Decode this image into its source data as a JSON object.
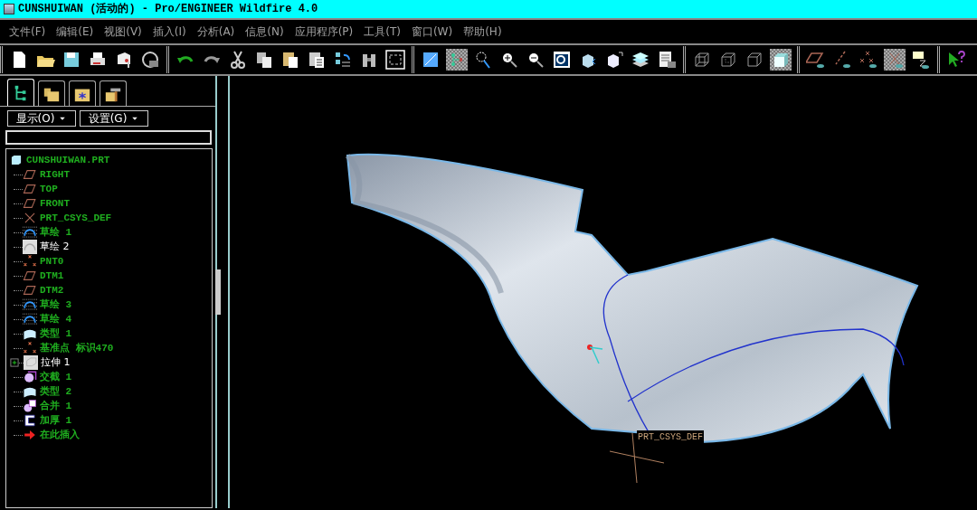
{
  "window": {
    "title": "CUNSHUIWAN (活动的) - Pro/ENGINEER Wildfire 4.0"
  },
  "menu": [
    "文件(F)",
    "编辑(E)",
    "视图(V)",
    "插入(I)",
    "分析(A)",
    "信息(N)",
    "应用程序(P)",
    "工具(T)",
    "窗口(W)",
    "帮助(H)"
  ],
  "toolbars": [
    {
      "buttons": [
        {
          "kind": "new",
          "on": false
        },
        {
          "kind": "open",
          "on": false
        },
        {
          "kind": "save",
          "on": false
        },
        {
          "kind": "print",
          "on": false
        },
        {
          "kind": "mail",
          "on": false
        },
        {
          "kind": "close",
          "on": false
        }
      ]
    },
    {
      "buttons": [
        {
          "kind": "undo",
          "on": false
        },
        {
          "kind": "redo",
          "on": false
        },
        {
          "kind": "cut",
          "on": false
        },
        {
          "kind": "copy",
          "on": false
        },
        {
          "kind": "paste",
          "on": false
        },
        {
          "kind": "paste-special",
          "on": false
        },
        {
          "kind": "regenerate",
          "on": false
        },
        {
          "kind": "binoculars",
          "on": false
        },
        {
          "kind": "select-box",
          "on": false
        }
      ]
    },
    {
      "buttons": [
        {
          "kind": "repaint",
          "on": false
        },
        {
          "kind": "spin-center",
          "on": true
        },
        {
          "kind": "orient",
          "on": false
        },
        {
          "kind": "zoom-in",
          "on": false
        },
        {
          "kind": "zoom-out",
          "on": false
        },
        {
          "kind": "refit",
          "on": false
        },
        {
          "kind": "reorient",
          "on": false
        },
        {
          "kind": "view-manager",
          "on": false
        },
        {
          "kind": "layers",
          "on": false
        },
        {
          "kind": "model-display",
          "on": false
        }
      ]
    },
    {
      "buttons": [
        {
          "kind": "wireframe",
          "on": false
        },
        {
          "kind": "hidden-line",
          "on": false
        },
        {
          "kind": "no-hidden",
          "on": false
        },
        {
          "kind": "shading",
          "on": true
        }
      ]
    },
    {
      "buttons": [
        {
          "kind": "plane",
          "on": false
        },
        {
          "kind": "axis",
          "on": false
        },
        {
          "kind": "point",
          "on": false
        },
        {
          "kind": "csys",
          "on": true
        },
        {
          "kind": "annotation",
          "on": false
        }
      ]
    },
    {
      "buttons": [
        {
          "kind": "help",
          "on": false
        }
      ]
    }
  ],
  "panel": {
    "tabs": [
      {
        "kind": "tree",
        "selected": true
      },
      {
        "kind": "folder",
        "selected": false
      },
      {
        "kind": "favorites",
        "selected": false
      },
      {
        "kind": "tools",
        "selected": false
      }
    ],
    "buttons": [
      "显示(O)",
      "设置(G)"
    ],
    "tree": {
      "root": "CUNSHUIWAN.PRT",
      "items": [
        {
          "label": "RIGHT",
          "kind": "plane",
          "highlighted": false,
          "expandable": false
        },
        {
          "label": "TOP",
          "kind": "plane",
          "highlighted": false,
          "expandable": false
        },
        {
          "label": "FRONT",
          "kind": "plane",
          "highlighted": false,
          "expandable": false
        },
        {
          "label": "PRT_CSYS_DEF",
          "kind": "csys",
          "highlighted": false,
          "expandable": false
        },
        {
          "label": "草绘 1",
          "kind": "sketch",
          "highlighted": false,
          "expandable": false
        },
        {
          "label": "草绘 2",
          "kind": "sketch-plain",
          "highlighted": true,
          "expandable": false
        },
        {
          "label": "PNT0",
          "kind": "point",
          "highlighted": false,
          "expandable": false
        },
        {
          "label": "DTM1",
          "kind": "plane",
          "highlighted": false,
          "expandable": false
        },
        {
          "label": "DTM2",
          "kind": "plane",
          "highlighted": false,
          "expandable": false
        },
        {
          "label": "草绘 3",
          "kind": "sketch",
          "highlighted": false,
          "expandable": false
        },
        {
          "label": "草绘 4",
          "kind": "sketch",
          "highlighted": false,
          "expandable": false
        },
        {
          "label": "类型 1",
          "kind": "surface",
          "highlighted": false,
          "expandable": false
        },
        {
          "label": "基准点 标识470",
          "kind": "point",
          "highlighted": false,
          "expandable": false
        },
        {
          "label": "拉伸 1",
          "kind": "extrude",
          "highlighted": true,
          "expandable": true
        },
        {
          "label": "交截 1",
          "kind": "intersect",
          "highlighted": false,
          "expandable": false
        },
        {
          "label": "类型 2",
          "kind": "surface",
          "highlighted": false,
          "expandable": false
        },
        {
          "label": "合并 1",
          "kind": "merge",
          "highlighted": false,
          "expandable": false
        },
        {
          "label": "加厚 1",
          "kind": "thicken",
          "highlighted": false,
          "expandable": false
        },
        {
          "label": "在此插入",
          "kind": "insert",
          "highlighted": false,
          "expandable": false
        }
      ]
    }
  },
  "graphics": {
    "csys_label": "PRT_CSYS_DEF"
  }
}
